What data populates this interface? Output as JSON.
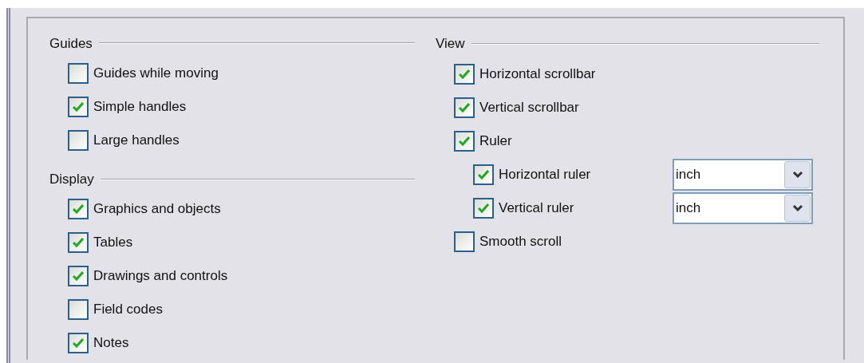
{
  "left_column": [
    {
      "title": "Guides",
      "items": [
        {
          "label": "Guides while moving",
          "checked": false
        },
        {
          "label": "Simple handles",
          "checked": true
        },
        {
          "label": "Large handles",
          "checked": false
        }
      ]
    },
    {
      "title": "Display",
      "items": [
        {
          "label": "Graphics and objects",
          "checked": true
        },
        {
          "label": "Tables",
          "checked": true
        },
        {
          "label": "Drawings and controls",
          "checked": true
        },
        {
          "label": "Field codes",
          "checked": false
        },
        {
          "label": "Notes",
          "checked": true
        }
      ]
    }
  ],
  "right_column": [
    {
      "title": "View",
      "items": [
        {
          "label": "Horizontal scrollbar",
          "checked": true
        },
        {
          "label": "Vertical scrollbar",
          "checked": true
        },
        {
          "label": "Ruler",
          "checked": true,
          "children": [
            {
              "label": "Horizontal ruler",
              "checked": true,
              "unit": "inch"
            },
            {
              "label": "Vertical ruler",
              "checked": true,
              "unit": "inch"
            }
          ]
        },
        {
          "label": "Smooth scroll",
          "checked": false
        }
      ]
    }
  ]
}
